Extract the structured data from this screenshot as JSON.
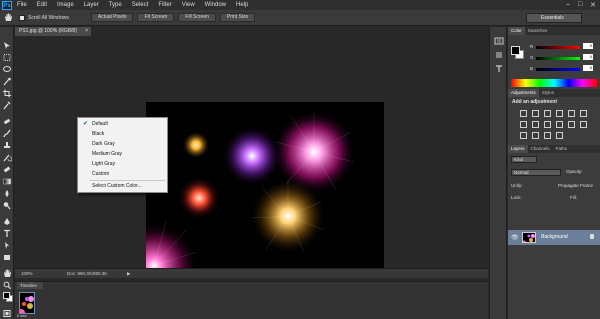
{
  "app": {
    "logo": "Ps"
  },
  "menubar": {
    "items": [
      "File",
      "Edit",
      "Image",
      "Layer",
      "Type",
      "Select",
      "Filter",
      "View",
      "Window",
      "Help"
    ]
  },
  "window_controls": {
    "minimize": "–",
    "maximize": "□",
    "close": "✕"
  },
  "options_bar": {
    "scroll_all_windows": "Scroll All Windows",
    "scroll_all_checked": true,
    "buttons": [
      "Actual Pixels",
      "Fit Screen",
      "Fill Screen",
      "Print Size"
    ],
    "workspace": "Essentials"
  },
  "document": {
    "tab_title": "PS1.jpg @ 100% (RGB/8)",
    "close_glyph": "×"
  },
  "status_bar": {
    "zoom": "100%",
    "doc_info": "Doc: 990,3K/990,3K",
    "arrow": "▶"
  },
  "timeline": {
    "title": "Timeline",
    "frame_label": "0 sec."
  },
  "context_menu": {
    "items": [
      "Default",
      "Black",
      "Dark Gray",
      "Medium Gray",
      "Light Gray",
      "Custom"
    ],
    "extra_item": "Select Custom Color...",
    "checked_item": "Default",
    "checkmark": "✔"
  },
  "color_panel": {
    "tabs": [
      "Color",
      "Swatches"
    ],
    "sliders": [
      {
        "label": "R",
        "value": "0",
        "gradient": "linear-gradient(to right,#000,#f00)"
      },
      {
        "label": "G",
        "value": "0",
        "gradient": "linear-gradient(to right,#000,#0f0)"
      },
      {
        "label": "B",
        "value": "0",
        "gradient": "linear-gradient(to right,#000,#00f)"
      }
    ]
  },
  "adjustments_panel": {
    "tabs": [
      "Adjustments",
      "Styles"
    ],
    "title": "Add an adjustment"
  },
  "layers_panel": {
    "tabs": [
      "Layers",
      "Channels",
      "Paths"
    ],
    "kind": "Kind",
    "blend_mode": "Normal",
    "opacity_label": "Opacity:",
    "unify_label": "Unify:",
    "propagate_label": "Propagate Frame",
    "lock_label": "Lock:",
    "fill_label": "Fill:",
    "layer_name": "Background",
    "eye": "👁"
  },
  "colors": {
    "accent": "#31a8ff",
    "selected_layer": "#6b7f9a",
    "panel_bg": "#3c3c3c",
    "canvas_bg": "#282828",
    "menu_bg": "#f2f2f2"
  },
  "icons": {
    "tools": [
      "move-icon",
      "marquee-icon",
      "lasso-icon",
      "quick-select-icon",
      "crop-icon",
      "eyedropper-icon",
      "healing-icon",
      "brush-icon",
      "clone-stamp-icon",
      "history-brush-icon",
      "eraser-icon",
      "gradient-icon",
      "blur-icon",
      "dodge-icon",
      "pen-icon",
      "type-icon",
      "path-select-icon",
      "shape-icon",
      "hand-icon",
      "zoom-icon"
    ]
  }
}
